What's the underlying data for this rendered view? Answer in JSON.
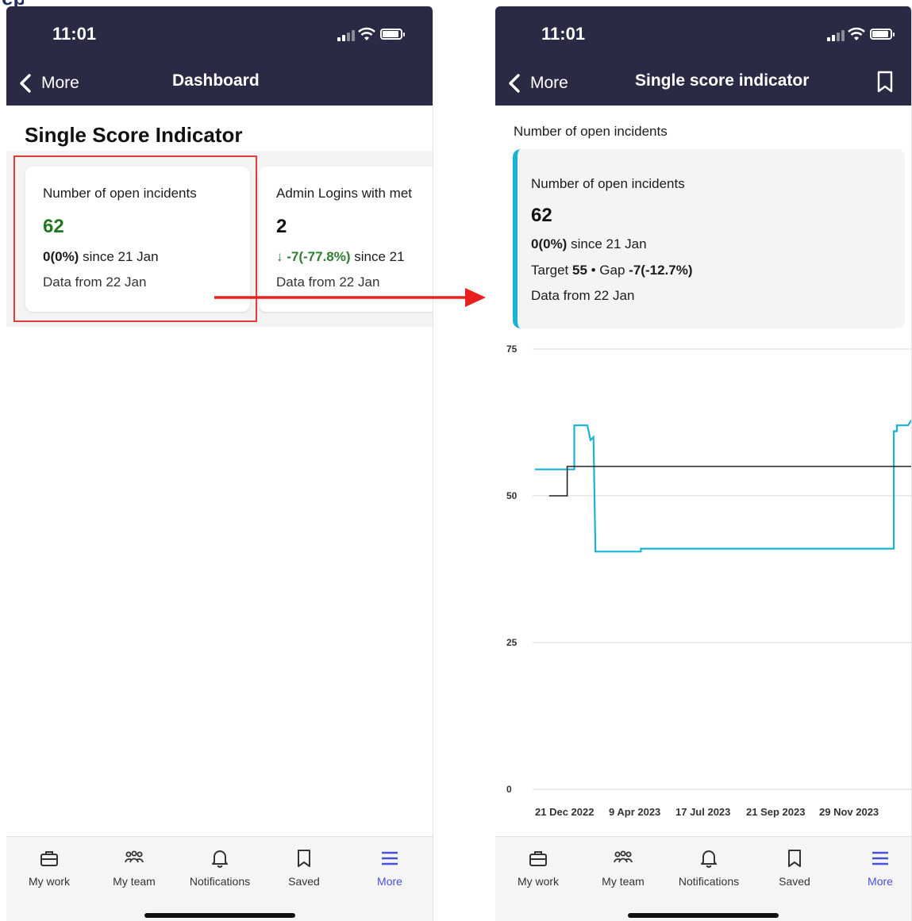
{
  "left_screen": {
    "status": {
      "time": "11:01"
    },
    "nav": {
      "back_label": "More",
      "title": "Dashboard"
    },
    "section_title": "Single Score Indicator",
    "cards": [
      {
        "title": "Number of open incidents",
        "value": "62",
        "value_color": "#1f7a1f",
        "delta_bold": "0(0%)",
        "delta_rest": " since 21 Jan",
        "data_from": "Data from 22 Jan"
      },
      {
        "title": "Admin Logins with met",
        "value": "2",
        "value_color": "#111111",
        "delta_bold": "↓ -7(-77.8%)",
        "delta_bold_color": "#2e7d32",
        "delta_rest": " since 21",
        "data_from": "Data from 22 Jan"
      }
    ]
  },
  "right_screen": {
    "status": {
      "time": "11:01"
    },
    "nav": {
      "back_label": "More",
      "title": "Single score indicator",
      "bookmark_icon": "bookmark-icon"
    },
    "label": "Number of open incidents",
    "detail": {
      "title": "Number of open incidents",
      "value": "62",
      "delta_bold": "0(0%)",
      "delta_rest": " since 21 Jan",
      "target_prefix": "Target ",
      "target_value": "55",
      "gap_prefix": " • Gap ",
      "gap_value": "-7(-12.7%)",
      "data_from": "Data from 22 Jan"
    }
  },
  "chart_data": {
    "type": "line",
    "title": "",
    "xlabel": "",
    "ylabel": "",
    "ylim": [
      0,
      75
    ],
    "y_ticks": [
      "0",
      "25",
      "50",
      "75"
    ],
    "x_ticks": [
      "21 Dec 2022",
      "9 Apr 2023",
      "17 Jul 2023",
      "21 Sep 2023",
      "29 Nov 2023"
    ],
    "grid": true,
    "series": [
      {
        "color": "#19b3d6",
        "points": [
          [
            "2022-12-21",
            54.5
          ],
          [
            "2023-01-29",
            54.5
          ],
          [
            "2023-01-29",
            62
          ],
          [
            "2023-02-11",
            62
          ],
          [
            "2023-02-14",
            59.5
          ],
          [
            "2023-02-17",
            60
          ],
          [
            "2023-02-19",
            40.5
          ],
          [
            "2023-04-05",
            40.5
          ],
          [
            "2023-04-05",
            41
          ],
          [
            "2023-12-12",
            41
          ],
          [
            "2023-12-12",
            61
          ],
          [
            "2023-12-15",
            61
          ],
          [
            "2023-12-15",
            62
          ],
          [
            "2023-12-26",
            62
          ],
          [
            "2023-12-30",
            63
          ]
        ]
      },
      {
        "color": "#222222",
        "points": [
          [
            "2023-01-04",
            50
          ],
          [
            "2023-01-22",
            50
          ],
          [
            "2023-01-22",
            55
          ],
          [
            "2023-12-30",
            55
          ]
        ]
      }
    ]
  },
  "tabbar": {
    "items": [
      {
        "label": "My work",
        "icon": "briefcase-icon"
      },
      {
        "label": "My team",
        "icon": "team-icon"
      },
      {
        "label": "Notifications",
        "icon": "bell-icon"
      },
      {
        "label": "Saved",
        "icon": "bookmark-icon"
      },
      {
        "label": "More",
        "icon": "menu-icon",
        "active": true
      }
    ],
    "active_color": "#4a4fd8"
  },
  "colors": {
    "header": "#2b2a45",
    "accent_cyan": "#19b3d6",
    "highlight_red": "#e23b3b",
    "positive_green": "#1f7a1f"
  }
}
